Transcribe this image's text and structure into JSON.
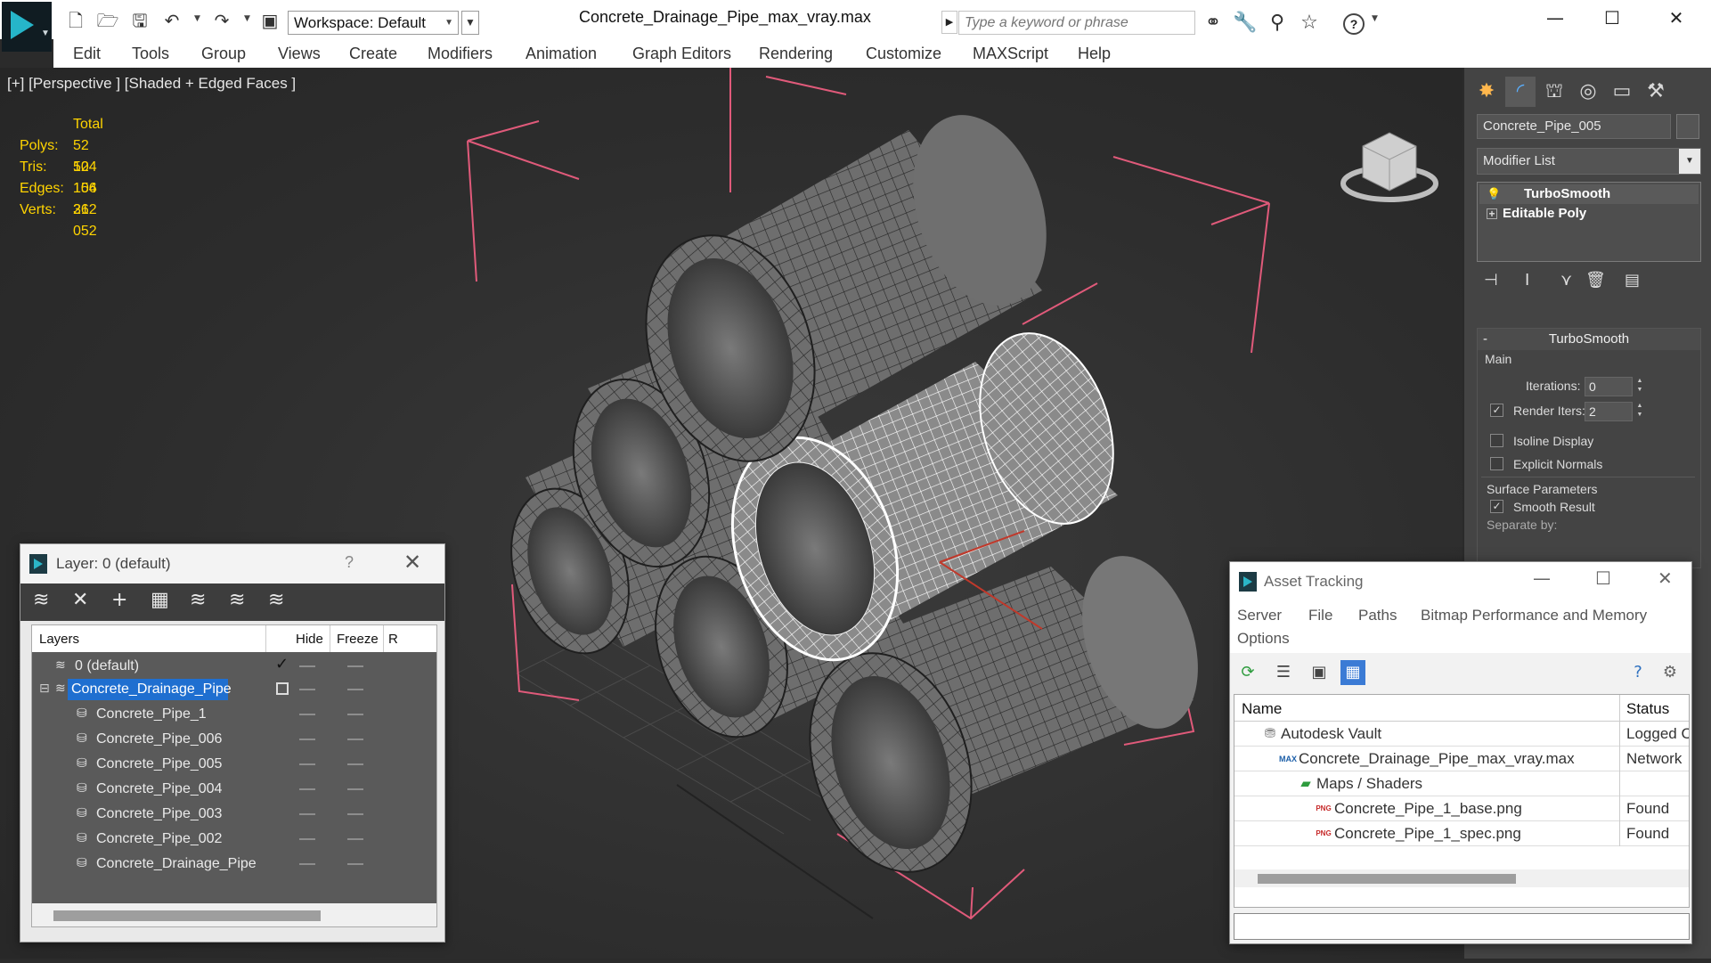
{
  "titlebar": {
    "workspace_label": "Workspace: Default",
    "filename": "Concrete_Drainage_Pipe_max_vray.max",
    "search_placeholder": "Type a keyword or phrase"
  },
  "menu": [
    "Edit",
    "Tools",
    "Group",
    "Views",
    "Create",
    "Modifiers",
    "Animation",
    "Graph Editors",
    "Rendering",
    "Customize",
    "MAXScript",
    "Help"
  ],
  "viewport": {
    "label": "[+] [Perspective ] [Shaded + Edged Faces ]",
    "stats": {
      "header": "Total",
      "rows": [
        {
          "k": "Polys:",
          "v": "52 104"
        },
        {
          "k": "Tris:",
          "v": "52 104"
        },
        {
          "k": "Edges:",
          "v": "156 312"
        },
        {
          "k": "Verts:",
          "v": "26 052"
        }
      ]
    }
  },
  "command_panel": {
    "object_name": "Concrete_Pipe_005",
    "modifier_list": "Modifier List",
    "stack": [
      "TurboSmooth",
      "Editable Poly"
    ],
    "rollout_title": "TurboSmooth",
    "group_main": "Main",
    "iterations_label": "Iterations:",
    "iterations_value": "0",
    "render_iters_label": "Render Iters:",
    "render_iters_value": "2",
    "isoline_label": "Isoline Display",
    "explicit_normals_label": "Explicit Normals",
    "surface_params": "Surface Parameters",
    "smooth_result": "Smooth Result",
    "separate_by": "Separate by:"
  },
  "layer_dialog": {
    "title": "Layer: 0 (default)",
    "help": "?",
    "columns": {
      "layers": "Layers",
      "hide": "Hide",
      "freeze": "Freeze",
      "r": "R"
    },
    "rows": [
      {
        "name": "0 (default)",
        "level": 0
      },
      {
        "name": "Concrete_Drainage_Pipe",
        "level": 0
      },
      {
        "name": "Concrete_Pipe_1",
        "level": 1
      },
      {
        "name": "Concrete_Pipe_006",
        "level": 1
      },
      {
        "name": "Concrete_Pipe_005",
        "level": 1
      },
      {
        "name": "Concrete_Pipe_004",
        "level": 1
      },
      {
        "name": "Concrete_Pipe_003",
        "level": 1
      },
      {
        "name": "Concrete_Pipe_002",
        "level": 1
      },
      {
        "name": "Concrete_Drainage_Pipe",
        "level": 1
      }
    ]
  },
  "asset_dialog": {
    "title": "Asset Tracking",
    "menu": [
      "Server",
      "File",
      "Paths",
      "Bitmap Performance and Memory",
      "Options"
    ],
    "columns": {
      "name": "Name",
      "status": "Status"
    },
    "rows": [
      {
        "name": "Autodesk Vault",
        "status": "Logged C"
      },
      {
        "name": "Concrete_Drainage_Pipe_max_vray.max",
        "status": "Network"
      },
      {
        "name": "Maps / Shaders",
        "status": ""
      },
      {
        "name": "Concrete_Pipe_1_base.png",
        "status": "Found"
      },
      {
        "name": "Concrete_Pipe_1_spec.png",
        "status": "Found"
      }
    ],
    "icon_max": "MAX",
    "icon_png": "PNG"
  },
  "colors": {
    "accent": "#1f6fd0",
    "stats_text": "#ffd400",
    "bbox": "#e05a7a",
    "viewport_bg": "#2d2d2d"
  }
}
